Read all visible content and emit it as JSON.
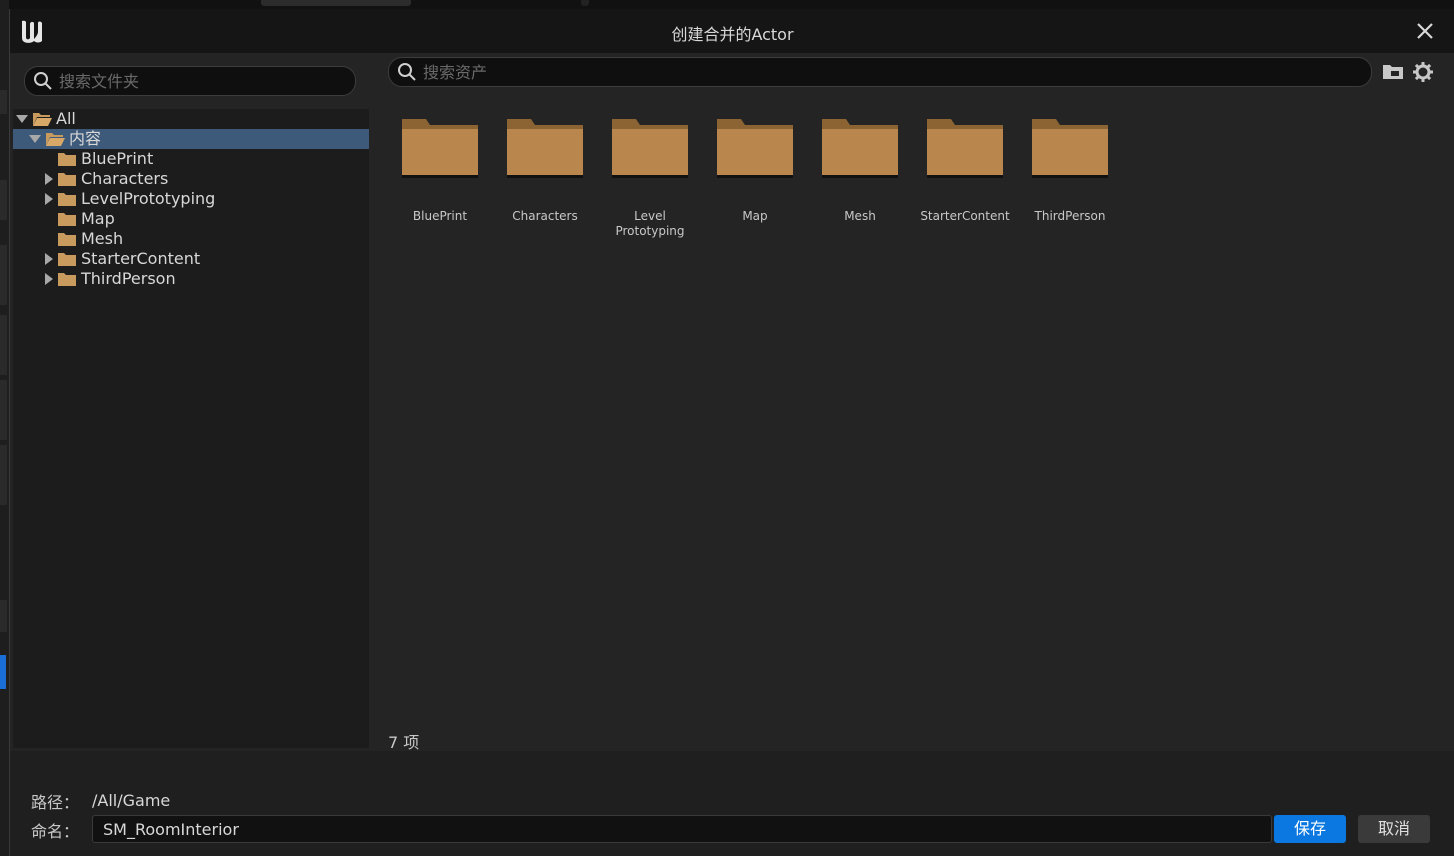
{
  "window": {
    "title": "创建合并的Actor"
  },
  "tree": {
    "search_placeholder": "搜索文件夹",
    "items": [
      {
        "label": "All",
        "expanded": true,
        "open_folder": true
      },
      {
        "label": "内容",
        "expanded": true,
        "open_folder": true,
        "selected": true
      },
      {
        "label": "BluePrint",
        "has_children": false
      },
      {
        "label": "Characters",
        "has_children": true
      },
      {
        "label": "LevelPrototyping",
        "has_children": true
      },
      {
        "label": "Map",
        "has_children": false
      },
      {
        "label": "Mesh",
        "has_children": false
      },
      {
        "label": "StarterContent",
        "has_children": true
      },
      {
        "label": "ThirdPerson",
        "has_children": true
      }
    ]
  },
  "assets": {
    "search_placeholder": "搜索资产",
    "folders": [
      {
        "caption": "BluePrint"
      },
      {
        "caption": "Characters"
      },
      {
        "caption": "Level\nPrototyping"
      },
      {
        "caption": "Map"
      },
      {
        "caption": "Mesh"
      },
      {
        "caption": "StarterContent"
      },
      {
        "caption": "ThirdPerson"
      }
    ],
    "count_text": "7 项",
    "icons": [
      "folder-view-icon",
      "settings-gear-icon"
    ]
  },
  "bottom": {
    "path_label": "路径：",
    "path_value": "/All/Game",
    "name_label": "命名：",
    "name_value": "SM_RoomInterior",
    "save_label": "保存",
    "cancel_label": "取消"
  },
  "colors": {
    "accent": "#0a78e0",
    "folder": "#b07e48",
    "selected_row": "#3e5a7a"
  }
}
